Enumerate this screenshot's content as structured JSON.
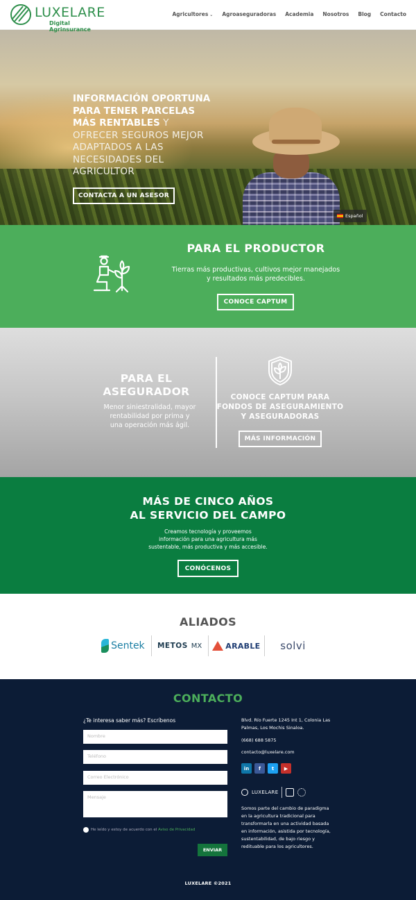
{
  "header": {
    "logo_word": "LUXELARE",
    "logo_sub": "Digital Agrinsurance",
    "nav": [
      {
        "label": "Agricultores",
        "dropdown": true
      },
      {
        "label": "Agroaseguradoras"
      },
      {
        "label": "Academia"
      },
      {
        "label": "Nosotros"
      },
      {
        "label": "Blog"
      },
      {
        "label": "Contacto"
      }
    ]
  },
  "hero": {
    "line1": "INFORMACIÓN OPORTUNA",
    "line2": "PARA TENER PARCELAS",
    "line3_bold": "MÁS RENTABLES",
    "line3_rest": " Y",
    "line4": "OFRECER SEGUROS MEJOR",
    "line5": "ADAPTADOS A LAS",
    "line6": "NECESIDADES DEL",
    "line7": "AGRICULTOR",
    "button": "CONTACTA A UN ASESOR",
    "language": "Español"
  },
  "productor": {
    "title": "PARA EL PRODUCTOR",
    "desc_line1": "Tierras más productivas, cultivos mejor manejados",
    "desc_line2": "y resultados más predecibles.",
    "button": "CONOCE CAPTUM"
  },
  "asegurador": {
    "title_line1": "PARA EL",
    "title_line2": "ASEGURADOR",
    "desc_line1": "Menor siniestralidad, mayor",
    "desc_line2": "rentabilidad por prima y",
    "desc_line3": "una operación más ágil.",
    "right_line1": "CONOCE CAPTUM PARA",
    "right_line2": "FONDOS DE ASEGURAMIENTO",
    "right_line3": "Y ASEGURADORAS",
    "button": "MÁS INFORMACIÓN"
  },
  "cinco": {
    "title_line1": "MÁS DE CINCO AÑOS",
    "title_line2": "AL SERVICIO DEL CAMPO",
    "desc_line1": "Creamos tecnología y proveemos",
    "desc_line2": "información para una agricultura más",
    "desc_line3": "sustentable, más productiva y más accesible.",
    "button": "CONÓCENOS"
  },
  "aliados": {
    "title": "ALIADOS",
    "partners": [
      "Sentek",
      "METOS",
      "MX",
      "ARABLE",
      "solvi"
    ]
  },
  "contacto": {
    "title": "CONTACTO",
    "question": "¿Te interesa saber más? Escríbenos",
    "placeholders": {
      "name": "Nombre",
      "phone": "Teléfono",
      "email": "Correo Electrónico",
      "message": "Mensaje"
    },
    "privacy_text": "He leído y estoy de acuerdo con el ",
    "privacy_link": "Aviso de Privacidad",
    "send": "ENVIAR",
    "address_line1": "Blvd. Río Fuerte 1245 Int 1, Colonia Las",
    "address_line2": "Palmas, Los Mochis Sinaloa.",
    "phone": "(668) 688 5875",
    "email": "contacto@luxelare.com",
    "social": [
      "in",
      "f",
      "t",
      "▶"
    ],
    "footer_logo_word": "LUXELARE",
    "about_line1": "Somos parte del cambio de paradigma",
    "about_line2": "en la agricultura tradicional para",
    "about_line3": "transformarla en una actividad basada",
    "about_line4": "en información, asistida por tecnología,",
    "about_line5": "sustentabilidad, de bajo riesgo y",
    "about_line6": "redituable para los agricultores.",
    "copyright": "LUXELARE ©2021"
  },
  "colors": {
    "brand_green": "#2e8f4b",
    "productor_bg": "#4cae5b",
    "cinco_bg": "#0a7d40",
    "footer_bg": "#0c1c36"
  }
}
